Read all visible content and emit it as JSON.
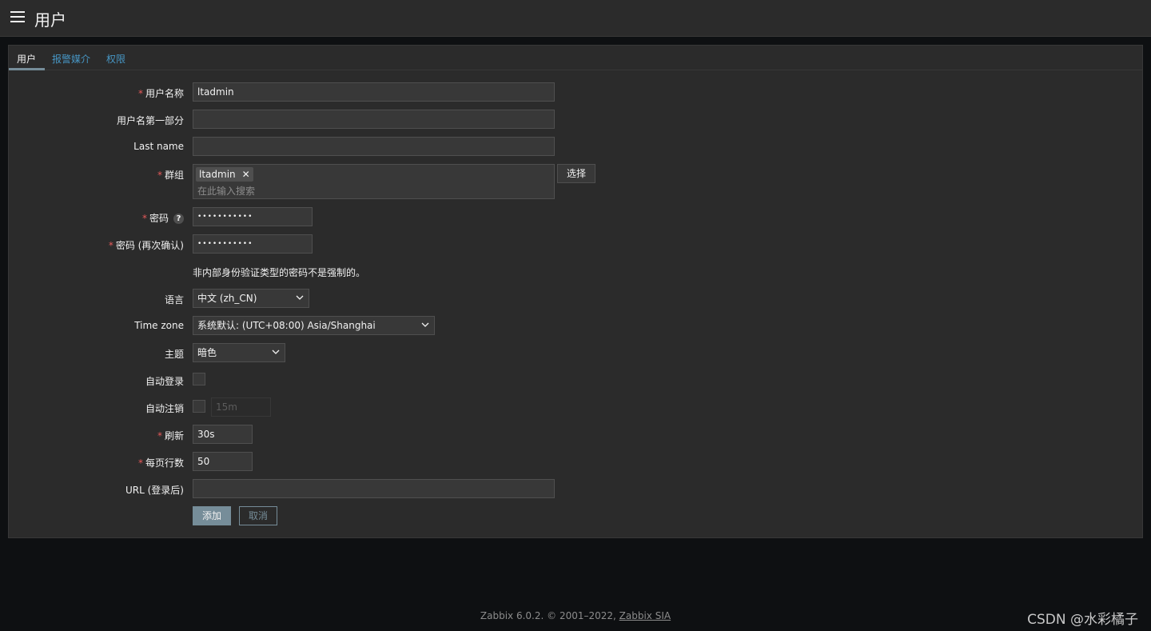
{
  "header": {
    "title": "用户",
    "menu_icon": "hamburger-menu-icon"
  },
  "tabs": [
    {
      "label": "用户",
      "active": true
    },
    {
      "label": "报警媒介",
      "active": false
    },
    {
      "label": "权限",
      "active": false
    }
  ],
  "form": {
    "username": {
      "label": "用户名称",
      "value": "ltadmin",
      "required": true
    },
    "first_name": {
      "label": "用户名第一部分",
      "value": ""
    },
    "last_name": {
      "label": "Last name",
      "value": ""
    },
    "groups": {
      "label": "群组",
      "chip": "ltadmin",
      "search_placeholder": "在此输入搜索",
      "select_label": "选择",
      "required": true
    },
    "password": {
      "label": "密码",
      "value": "•••••••••••",
      "required": true,
      "help": "?"
    },
    "password_confirm": {
      "label": "密码 (再次确认)",
      "value": "•••••••••••",
      "required": true
    },
    "password_note": "非内部身份验证类型的密码不是强制的。",
    "language": {
      "label": "语言",
      "value": "中文 (zh_CN)"
    },
    "timezone": {
      "label": "Time zone",
      "value": "系统默认: (UTC+08:00) Asia/Shanghai"
    },
    "theme": {
      "label": "主题",
      "value": "暗色"
    },
    "autologin": {
      "label": "自动登录",
      "checked": false
    },
    "autologout": {
      "label": "自动注销",
      "checked": false,
      "value": "15m"
    },
    "refresh": {
      "label": "刷新",
      "value": "30s",
      "required": true
    },
    "rows_per_page": {
      "label": "每页行数",
      "value": "50",
      "required": true
    },
    "url": {
      "label": "URL (登录后)",
      "value": ""
    },
    "add_label": "添加",
    "cancel_label": "取消"
  },
  "footer": {
    "text": "Zabbix 6.0.2. © 2001–2022, ",
    "link": "Zabbix SIA"
  },
  "watermark": "CSDN @水彩橘子",
  "colors": {
    "accent": "#768d99",
    "link": "#4796c4",
    "required": "#e45959",
    "bg": "#0e1012",
    "panel": "#2b2b2b"
  }
}
